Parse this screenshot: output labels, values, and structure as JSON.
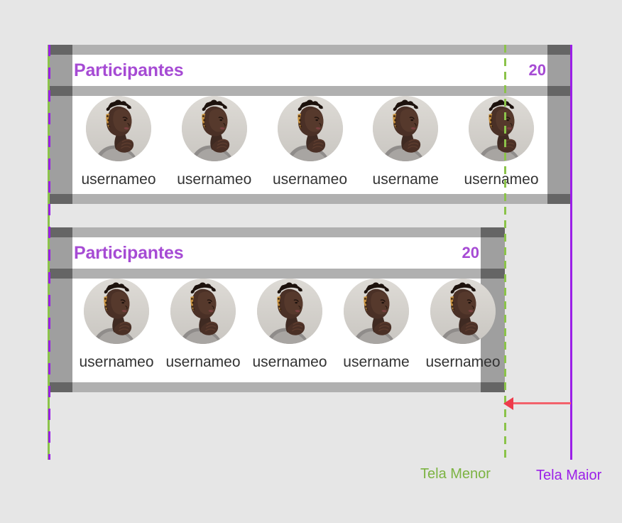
{
  "page": {
    "background_color": "#e6e6e6",
    "title": "Responsive layout comparison mockup"
  },
  "colors": {
    "accent_purple": "#a64bd4",
    "guide_purple": "#9b1fe8",
    "guide_green": "#8bc34a",
    "label_green": "#7cb342",
    "arrow_red": "#f2626b",
    "gutter_light": "#b0b0b0",
    "gutter_dark": "#656565",
    "gutter_mid": "#9f9f9f",
    "card_background": "#ffffff",
    "name_text": "#333333"
  },
  "cards": [
    {
      "id": "card-large-screen",
      "header": {
        "title": "Participantes",
        "count": "20"
      },
      "participants": [
        {
          "name": "usernameo",
          "avatar": "user-avatar-photo"
        },
        {
          "name": "usernameo",
          "avatar": "user-avatar-photo"
        },
        {
          "name": "usernameo",
          "avatar": "user-avatar-photo"
        },
        {
          "name": "username",
          "avatar": "user-avatar-photo"
        },
        {
          "name": "usernameo",
          "avatar": "user-avatar-photo"
        }
      ]
    },
    {
      "id": "card-small-screen",
      "header": {
        "title": "Participantes",
        "count": "20"
      },
      "participants": [
        {
          "name": "usernameo",
          "avatar": "user-avatar-photo"
        },
        {
          "name": "usernameo",
          "avatar": "user-avatar-photo"
        },
        {
          "name": "usernameo",
          "avatar": "user-avatar-photo"
        },
        {
          "name": "username",
          "avatar": "user-avatar-photo"
        },
        {
          "name": "usernameo",
          "avatar": "user-avatar-photo"
        }
      ]
    }
  ],
  "annotations": {
    "small_screen_label": "Tela Menor",
    "large_screen_label": "Tela Maior",
    "arrow": "shrink-arrow-left"
  }
}
